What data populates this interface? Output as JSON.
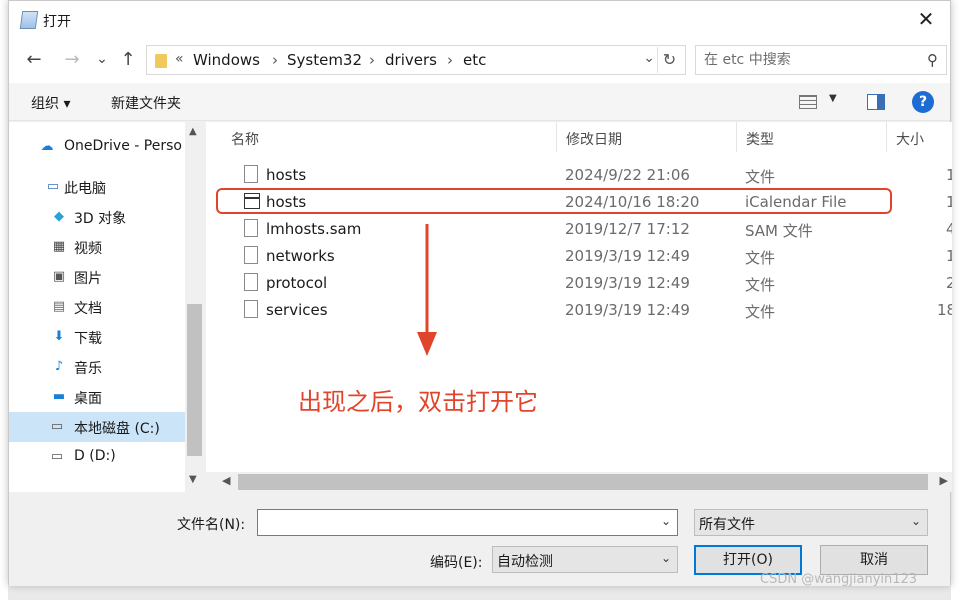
{
  "window": {
    "title": "打开"
  },
  "nav": {
    "back": "←",
    "forward": "→",
    "recent": "⌄",
    "up": "↑",
    "breadcrumb": [
      "Windows",
      "System32",
      "drivers",
      "etc"
    ],
    "search_placeholder": "在 etc 中搜索"
  },
  "toolbar": {
    "organize": "组织 ▾",
    "new_folder": "新建文件夹",
    "help": "?"
  },
  "sidebar": {
    "items": [
      {
        "label": "OneDrive - Perso",
        "icon": "cloud-icon"
      },
      {
        "label": "此电脑",
        "icon": "computer-icon"
      },
      {
        "label": "3D 对象",
        "icon": "cube-icon"
      },
      {
        "label": "视频",
        "icon": "video-icon"
      },
      {
        "label": "图片",
        "icon": "picture-icon"
      },
      {
        "label": "文档",
        "icon": "document-icon"
      },
      {
        "label": "下载",
        "icon": "download-icon"
      },
      {
        "label": "音乐",
        "icon": "music-icon"
      },
      {
        "label": "桌面",
        "icon": "desktop-icon"
      },
      {
        "label": "本地磁盘 (C:)",
        "icon": "drive-icon",
        "selected": true
      },
      {
        "label": "D (D:)",
        "icon": "drive-icon"
      }
    ]
  },
  "files": {
    "columns": [
      "名称",
      "修改日期",
      "类型",
      "大小"
    ],
    "rows": [
      {
        "name": "hosts",
        "date": "2024/9/22 21:06",
        "type": "文件",
        "size": "1",
        "icon": "file-icon"
      },
      {
        "name": "hosts",
        "date": "2024/10/16 18:20",
        "type": "iCalendar File",
        "size": "1",
        "icon": "calendar-file-icon"
      },
      {
        "name": "lmhosts.sam",
        "date": "2019/12/7 17:12",
        "type": "SAM 文件",
        "size": "4",
        "icon": "file-icon"
      },
      {
        "name": "networks",
        "date": "2019/3/19 12:49",
        "type": "文件",
        "size": "1",
        "icon": "file-icon"
      },
      {
        "name": "protocol",
        "date": "2019/3/19 12:49",
        "type": "文件",
        "size": "2",
        "icon": "file-icon"
      },
      {
        "name": "services",
        "date": "2019/3/19 12:49",
        "type": "文件",
        "size": "18",
        "icon": "file-icon"
      }
    ]
  },
  "bottom": {
    "filename_label": "文件名(N):",
    "filename_value": "",
    "filetype_value": "所有文件",
    "encoding_label": "编码(E):",
    "encoding_value": "自动检测",
    "open_button": "打开(O)",
    "cancel_button": "取消"
  },
  "annotation": {
    "text": "出现之后，双击打开它",
    "color": "#e0452b"
  },
  "watermark": "CSDN @wangjianyin123",
  "colors": {
    "selection": "#cce4f7",
    "accent": "#0078d7",
    "annotation": "#e0452b"
  }
}
